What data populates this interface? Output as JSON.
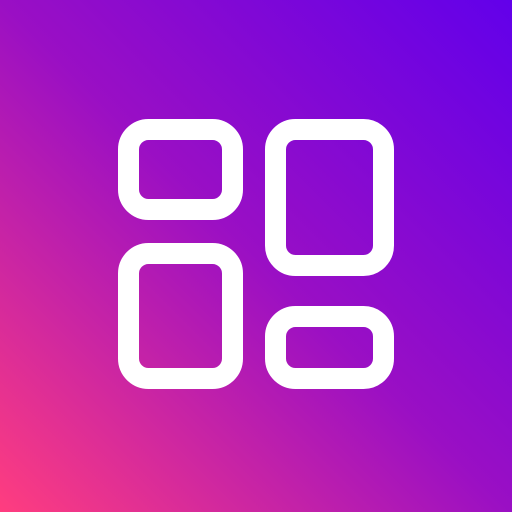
{
  "icon": {
    "name": "dashboard-layout-icon",
    "glyph_color": "#ffffff",
    "background_gradient": {
      "bottom_left": "#ff3d7f",
      "middle": "#9a0fc4",
      "top_right": "#6200ea"
    }
  }
}
